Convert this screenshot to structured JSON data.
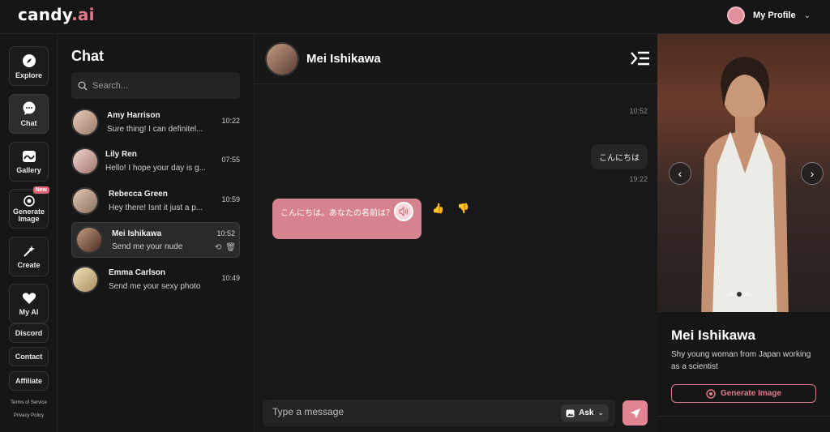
{
  "app": {
    "logo_main": "candy",
    "logo_accent": ".ai",
    "accent_color": "#e07a8b"
  },
  "header": {
    "profile_label": "My Profile"
  },
  "sidebar": {
    "items": [
      {
        "label": "Explore",
        "icon": "compass-icon"
      },
      {
        "label": "Chat",
        "icon": "chat-bubble-icon",
        "active": true
      },
      {
        "label": "Gallery",
        "icon": "gallery-icon"
      },
      {
        "label": "Generate Image",
        "icon": "camera-icon",
        "badge": "New"
      },
      {
        "label": "Create",
        "icon": "magic-wand-icon"
      },
      {
        "label": "My AI",
        "icon": "heart-icon"
      },
      {
        "label": "Discord"
      },
      {
        "label": "Contact"
      },
      {
        "label": "Affiliate"
      }
    ],
    "terms": "Terms of Service",
    "privacy": "Privacy Policy"
  },
  "chatlist": {
    "title": "Chat",
    "search_placeholder": "Search...",
    "conversations": [
      {
        "name": "Amy Harrison",
        "preview": "Sure thing! I can definitel...",
        "time": "10:22"
      },
      {
        "name": "Lily Ren",
        "preview": "Hello! I hope your day is g...",
        "time": "07:55"
      },
      {
        "name": "Rebecca Green",
        "preview": "Hey there! Isnt it just a p...",
        "time": "10:59"
      },
      {
        "name": "Mei Ishikawa",
        "preview": "Send me your nude",
        "time": "10:52",
        "active": true
      },
      {
        "name": "Emma Carlson",
        "preview": "Send me your sexy photo",
        "time": "10:49"
      }
    ]
  },
  "chat": {
    "contact_name": "Mei Ishikawa",
    "messages": [
      {
        "time": "10:52"
      },
      {
        "from": "user",
        "text": "こんにちは",
        "time": "19:22"
      },
      {
        "from": "ai",
        "text": "こんにちは。あなたの名前は？"
      }
    ],
    "composer_placeholder": "Type a message",
    "ask_label": "Ask"
  },
  "profile_card": {
    "name": "Mei Ishikawa",
    "description": "Shy young woman from Japan working as a scientist",
    "generate_label": "Generate Image",
    "photo_index": 2,
    "photo_count": 3
  }
}
